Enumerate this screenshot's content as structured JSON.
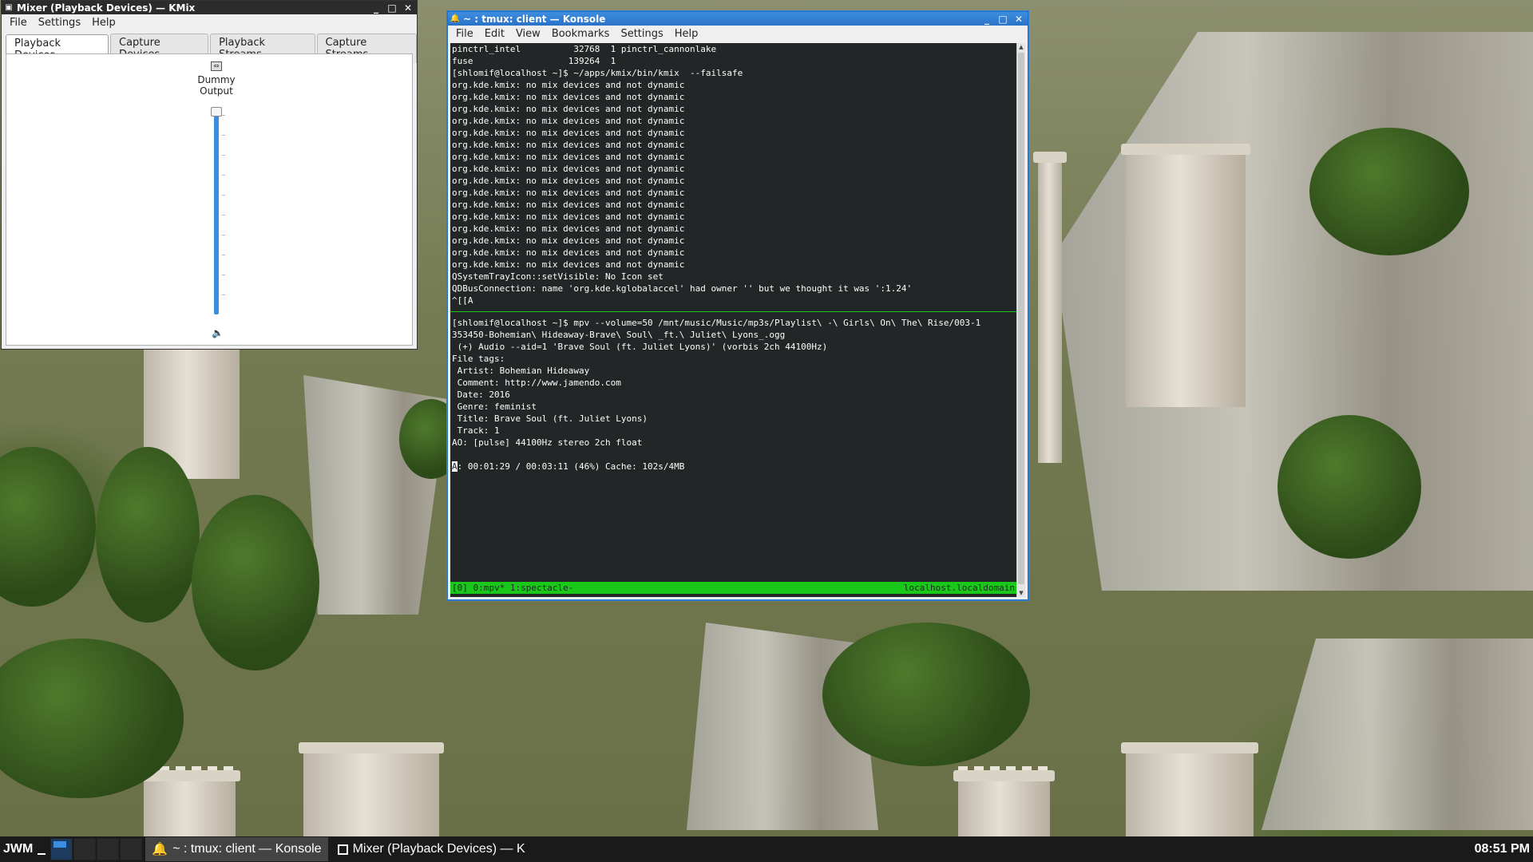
{
  "desktop": {},
  "kmix": {
    "title": "Mixer (Playback Devices) — KMix",
    "menu": [
      "File",
      "Settings",
      "Help"
    ],
    "tabs": [
      "Playback Devices",
      "Capture Devices",
      "Playback Streams",
      "Capture Streams"
    ],
    "selected_tab": "Playback Devices",
    "channel": {
      "label_line1": "Dummy",
      "label_line2": "Output",
      "volume_fraction": 1.0
    }
  },
  "konsole": {
    "title": "~ : tmux: client — Konsole",
    "menu": [
      "File",
      "Edit",
      "View",
      "Bookmarks",
      "Settings",
      "Help"
    ],
    "upper_pane_lines": [
      "pinctrl_intel          32768  1 pinctrl_cannonlake",
      "fuse                  139264  1",
      "[shlomif@localhost ~]$ ~/apps/kmix/bin/kmix  --failsafe",
      "org.kde.kmix: no mix devices and not dynamic",
      "org.kde.kmix: no mix devices and not dynamic",
      "org.kde.kmix: no mix devices and not dynamic",
      "org.kde.kmix: no mix devices and not dynamic",
      "org.kde.kmix: no mix devices and not dynamic",
      "org.kde.kmix: no mix devices and not dynamic",
      "org.kde.kmix: no mix devices and not dynamic",
      "org.kde.kmix: no mix devices and not dynamic",
      "org.kde.kmix: no mix devices and not dynamic",
      "org.kde.kmix: no mix devices and not dynamic",
      "org.kde.kmix: no mix devices and not dynamic",
      "org.kde.kmix: no mix devices and not dynamic",
      "org.kde.kmix: no mix devices and not dynamic",
      "org.kde.kmix: no mix devices and not dynamic",
      "org.kde.kmix: no mix devices and not dynamic",
      "org.kde.kmix: no mix devices and not dynamic",
      "QSystemTrayIcon::setVisible: No Icon set",
      "QDBusConnection: name 'org.kde.kglobalaccel' had owner '' but we thought it was ':1.24'",
      "^[[A"
    ],
    "lower_pane_lines": [
      "[shlomif@localhost ~]$ mpv --volume=50 /mnt/music/Music/mp3s/Playlist\\ -\\ Girls\\ On\\ The\\ Rise/003-1",
      "353450-Bohemian\\ Hideaway-Brave\\ Soul\\ _ft.\\ Juliet\\ Lyons_.ogg",
      " (+) Audio --aid=1 'Brave Soul (ft. Juliet Lyons)' (vorbis 2ch 44100Hz)",
      "File tags:",
      " Artist: Bohemian Hideaway",
      " Comment: http://www.jamendo.com",
      " Date: 2016",
      " Genre: feminist",
      " Title: Brave Soul (ft. Juliet Lyons)",
      " Track: 1",
      "AO: [pulse] 44100Hz stereo 2ch float",
      ""
    ],
    "status_cursor_char": "A",
    "status_line_rest": ": 00:01:29 / 00:03:11 (46%) Cache: 102s/4MB",
    "tmux_status_left": "[0] 0:mpv* 1:spectacle-",
    "tmux_status_right": "localhost.localdomain"
  },
  "taskbar": {
    "menu_label": "JWM",
    "tasks": [
      {
        "label": "~ : tmux: client — Konsole",
        "icon": "bell-icon",
        "active": true
      },
      {
        "label": "Mixer (Playback Devices) — K",
        "icon": "window-icon",
        "active": false
      }
    ],
    "clock": "08:51 PM"
  },
  "colors": {
    "window_active_title": "#2a72c8",
    "terminal_bg": "#232627",
    "tmux_status": "#19c819",
    "slider": "#3a8ee0"
  }
}
